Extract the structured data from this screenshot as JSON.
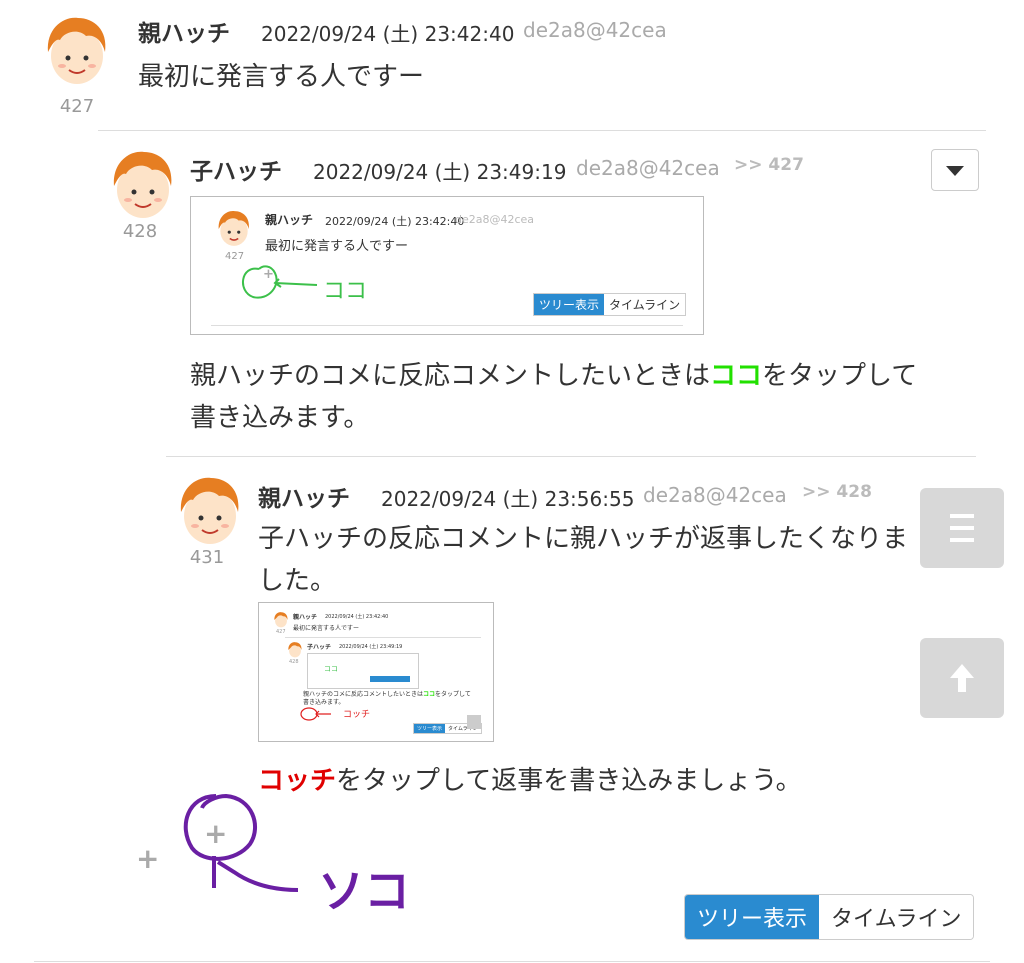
{
  "post427": {
    "name": "親ハッチ",
    "date": "2022/09/24 (土) 23:42:40",
    "uid": "de2a8@42cea",
    "body": "最初に発言する人ですー",
    "number": "427"
  },
  "post428": {
    "name": "子ハッチ",
    "date": "2022/09/24 (土) 23:49:19",
    "uid": "de2a8@42cea",
    "reply_to": ">> 427",
    "number": "428",
    "body_pre": "親ハッチのコメに反応コメントしたいときは",
    "body_highlight": "ココ",
    "body_post": "をタップして",
    "body_line2": "書き込みます。"
  },
  "post431": {
    "name": "親ハッチ",
    "date": "2022/09/24 (土) 23:56:55",
    "uid": "de2a8@42cea",
    "reply_to": ">> 428",
    "number": "431",
    "body_line1": "子ハッチの反応コメントに親ハッチが返事したくなりま",
    "body_line2": "した。",
    "body_highlight": "コッチ",
    "body_post": "をタップして返事を書き込みましょう。"
  },
  "shot1": {
    "name": "親ハッチ",
    "date": "2022/09/24 (土) 23:42:40",
    "uid": "de2a8@42cea",
    "body": "最初に発言する人ですー",
    "number": "427",
    "annotation": "ココ",
    "tree_label": "ツリー表示",
    "timeline_label": "タイムライン"
  },
  "shot2": {
    "row1_name": "親ハッチ",
    "row1_date": "2022/09/24 (土) 23:42:40",
    "row1_body": "最初に発言する人ですー",
    "row1_number": "427",
    "row2_name": "子ハッチ",
    "row2_date": "2022/09/24 (土) 23:49:19",
    "row2_number": "428",
    "row2_annotation": "ココ",
    "row2_body_pre": "親ハッチのコメに反応コメントしたいときは",
    "row2_body_hl": "ココ",
    "row2_body_post": "をタップして",
    "row2_body_line2": "書き込みます。",
    "annotation": "コッチ",
    "tree_label": "ツリー表示",
    "timeline_label": "タイムライン"
  },
  "annotation_main": "ソコ",
  "view_toggle": {
    "tree_label": "ツリー表示",
    "timeline_label": "タイムライン"
  },
  "icons": {
    "avatar": "avatar-icon",
    "menu": "chevron-down-icon",
    "hamburger": "menu-icon",
    "scroll_top": "arrow-up-icon",
    "add": "plus-icon"
  },
  "colors": {
    "accent": "#2a8bd0",
    "highlight_green": "#22e000",
    "highlight_red": "#e00000",
    "annotation_purple": "#6a1fa3",
    "annotation_green": "#3cc04a"
  }
}
